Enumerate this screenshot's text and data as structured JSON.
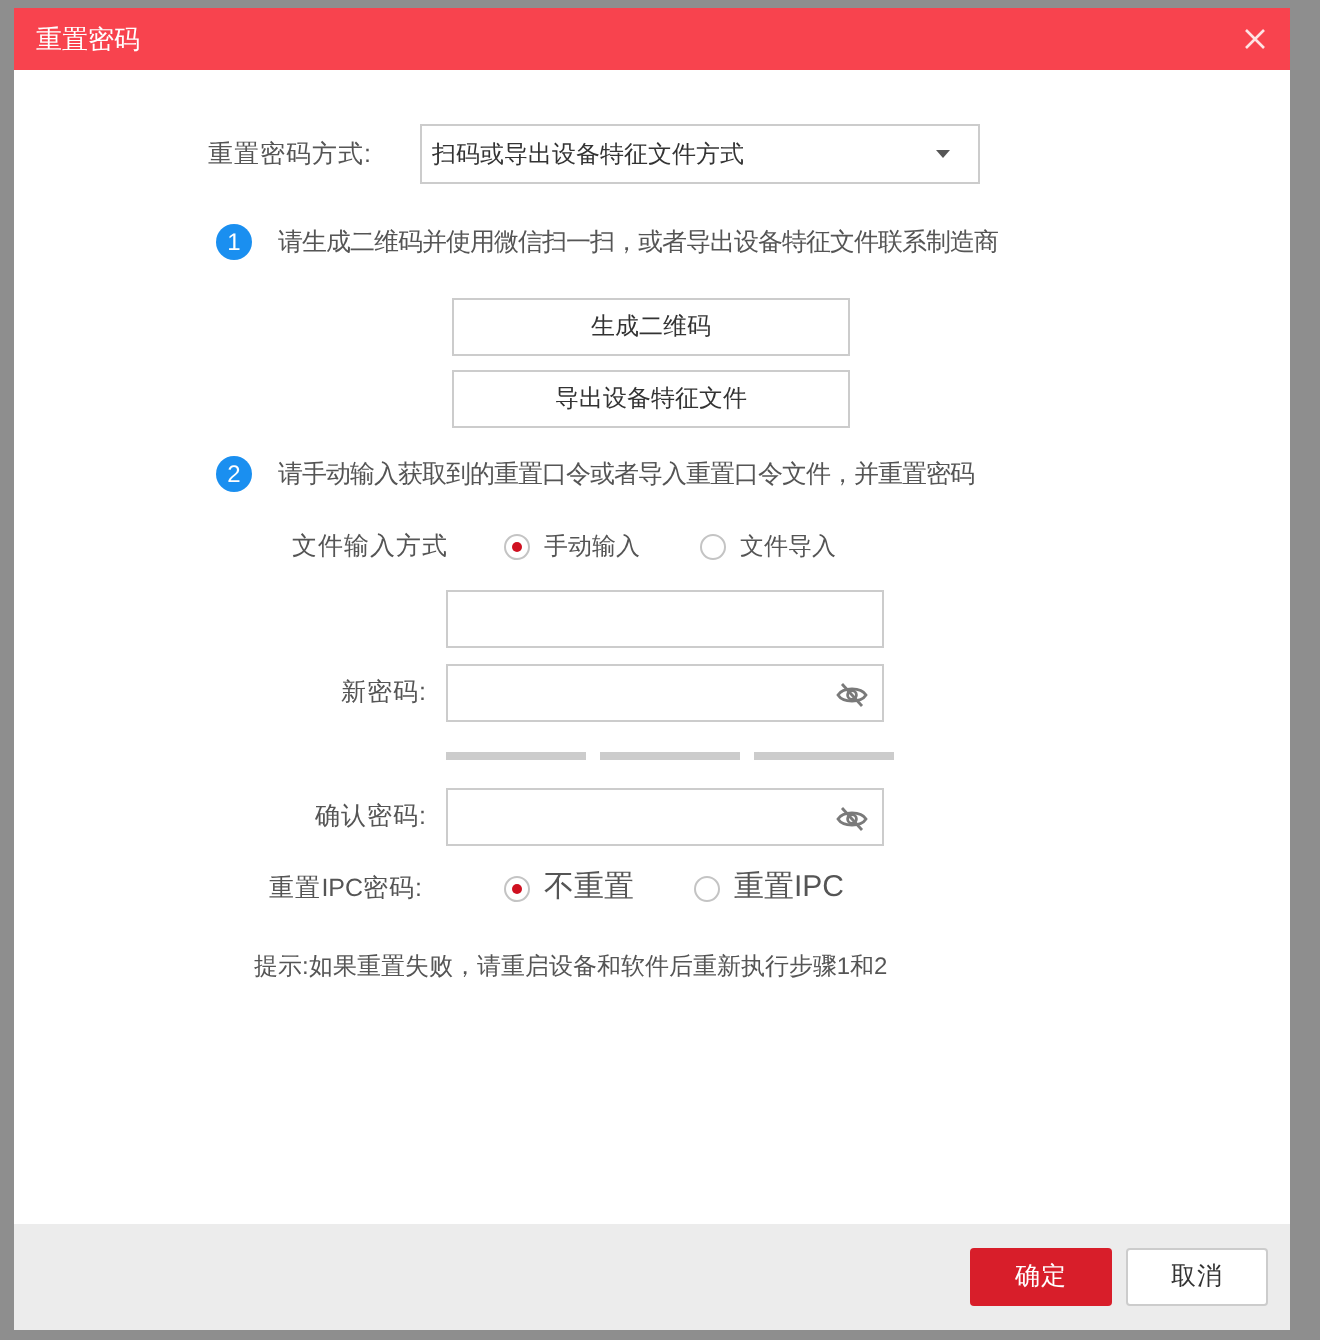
{
  "dialog": {
    "title": "重置密码"
  },
  "reset_method": {
    "label": "重置密码方式:",
    "value": "扫码或导出设备特征文件方式"
  },
  "step_1": {
    "number": "1",
    "text": "请生成二维码并使用微信扫一扫，或者导出设备特征文件联系制造商",
    "buttons": [
      "生成二维码",
      "导出设备特征文件"
    ]
  },
  "step_2": {
    "number": "2",
    "text": "请手动输入获取到的重置口令或者导入重置口令文件，并重置密码"
  },
  "input_method": {
    "label": "文件输入方式",
    "options": [
      {
        "label": "手动输入",
        "selected": true
      },
      {
        "label": "文件导入",
        "selected": false
      }
    ]
  },
  "new_password": {
    "label": "新密码:"
  },
  "confirm_password": {
    "label": "确认密码:"
  },
  "reset_ipc": {
    "label": "重置IPC密码:",
    "options": [
      {
        "label": "不重置",
        "selected": true
      },
      {
        "label": "重置IPC",
        "selected": false
      }
    ]
  },
  "hint": "提示:如果重置失败，请重启设备和软件后重新执行步骤1和2",
  "footer": {
    "buttons": [
      {
        "label": "确定",
        "kind": "primary"
      },
      {
        "label": "取消",
        "kind": "secondary"
      }
    ]
  }
}
